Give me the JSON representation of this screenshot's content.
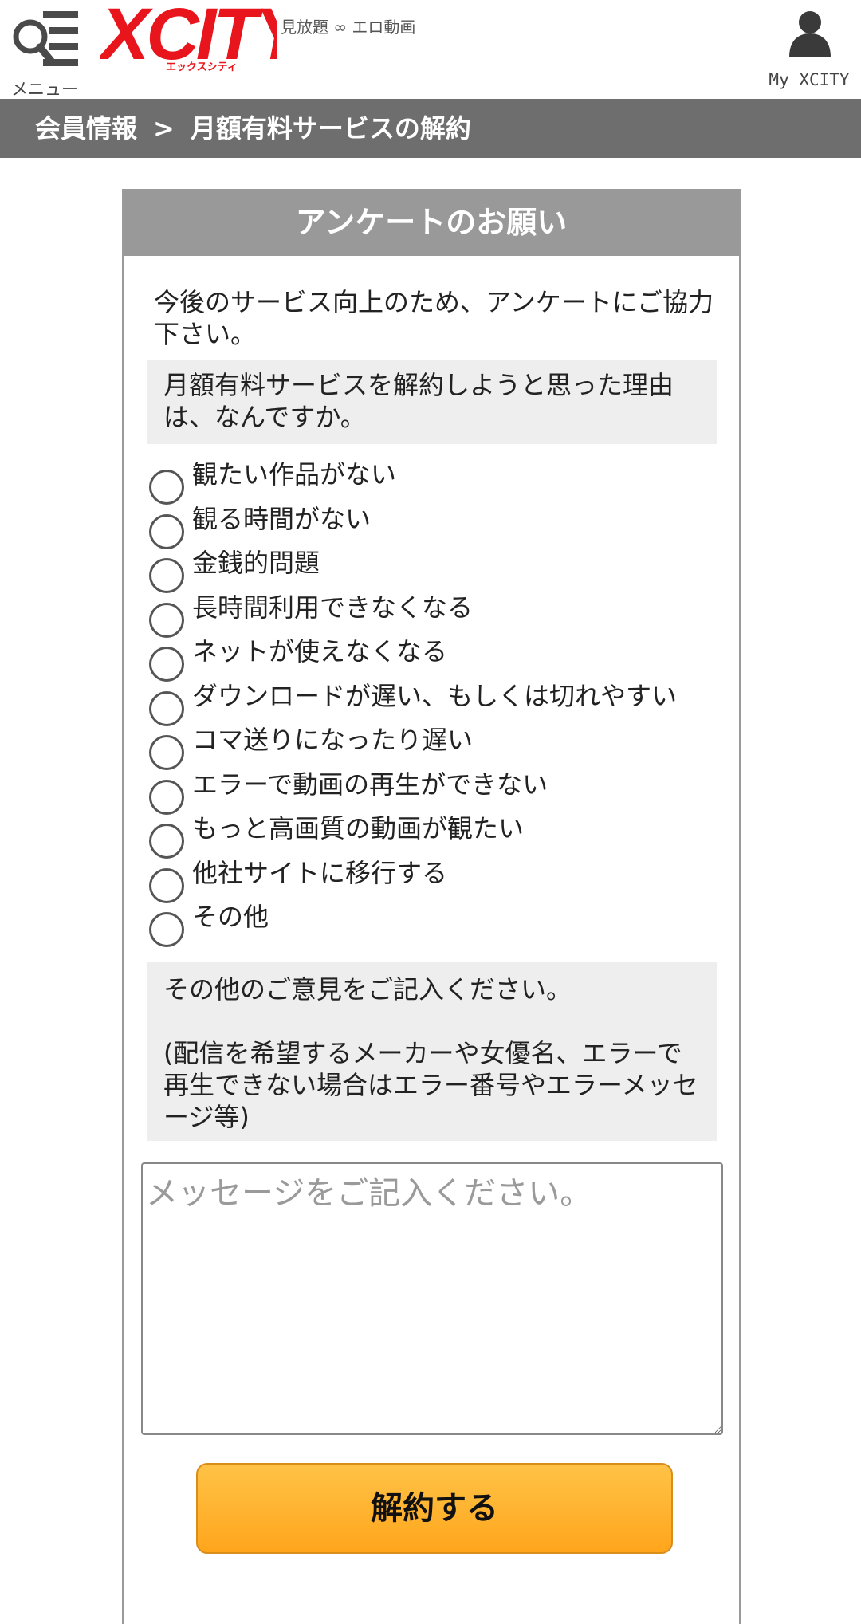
{
  "header": {
    "menu_label": "メニュー",
    "logo_text": "XCITY",
    "logo_sub": "エックスシティ",
    "tagline": "見放題 ∞ エロ動画",
    "my_label": "My XCITY",
    "brand_color": "#e8151c"
  },
  "breadcrumb": {
    "parent": "会員情報",
    "separator": ">",
    "current": "月額有料サービスの解約"
  },
  "survey": {
    "title": "アンケートのお願い",
    "intro": "今後のサービス向上のため、アンケートにご協力下さい。",
    "question": "月額有料サービスを解約しようと思った理由は、なんですか。",
    "options": [
      "観たい作品がない",
      "観る時間がない",
      "金銭的問題",
      "長時間利用できなくなる",
      "ネットが使えなくなる",
      "ダウンロードが遅い、もしくは切れやすい",
      "コマ送りになったり遅い",
      "エラーで動画の再生ができない",
      "もっと高画質の動画が観たい",
      "他社サイトに移行する",
      "その他"
    ],
    "other_prompt": "その他のご意見をご記入ください。",
    "other_note": "(配信を希望するメーカーや女優名、エラーで再生できない場合はエラー番号やエラーメッセージ等)",
    "message_placeholder": "メッセージをご記入ください。",
    "submit_label": "解約する",
    "button_color": "#ffb02e"
  }
}
